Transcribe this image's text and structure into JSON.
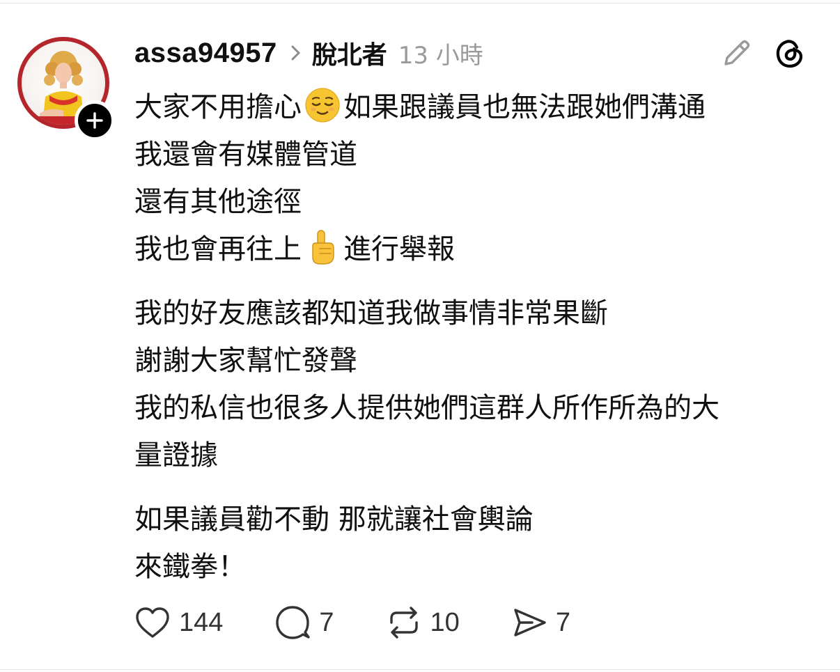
{
  "post": {
    "username": "assa94957",
    "topic": "脫北者",
    "timestamp": "13 小時",
    "lines": [
      {
        "before": "大家不用擔心",
        "emoji": "relieved-face-emoji",
        "after": "如果跟議員也無法跟她們溝通"
      },
      {
        "text": "我還會有媒體管道"
      },
      {
        "text": "還有其他途徑"
      },
      {
        "before": "我也會再往上",
        "emoji": "pointing-up-emoji",
        "after": "進行舉報"
      },
      {
        "text": "我的好友應該都知道我做事情非常果斷"
      },
      {
        "text": "謝謝大家幫忙發聲"
      },
      {
        "text": "我的私信也很多人提供她們這群人所作所為的大"
      },
      {
        "text": "量證據"
      },
      {
        "text": "如果議員勸不動 那就讓社會輿論"
      },
      {
        "text": "來鐵拳！"
      }
    ]
  },
  "actions": {
    "likes": "144",
    "replies": "7",
    "reposts": "10",
    "shares": "7"
  },
  "icons": {
    "follow": "plus-icon",
    "separator": "chevron-right-icon",
    "edit": "pencil-icon",
    "app": "threads-logo-icon",
    "like": "heart-icon",
    "reply": "speech-bubble-icon",
    "repost": "repost-icon",
    "share": "send-icon"
  },
  "colors": {
    "text": "#101010",
    "muted": "#9a9a9a",
    "avatar_ring": "#b5252c"
  }
}
